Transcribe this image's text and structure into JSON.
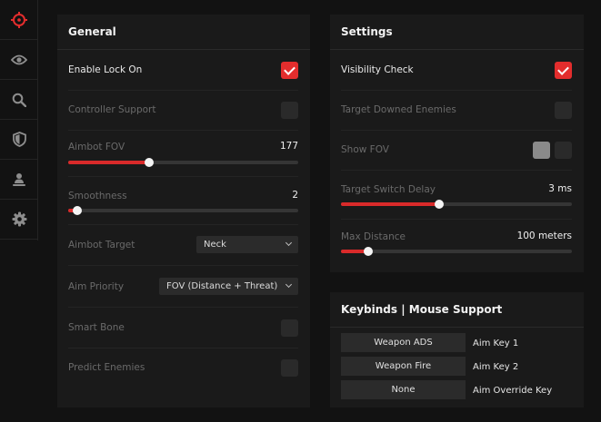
{
  "colors": {
    "accent": "#e32d2d",
    "panel": "#1a1a1a",
    "background": "#121212"
  },
  "sidebar": {
    "items": [
      {
        "icon": "crosshair-icon"
      },
      {
        "icon": "eye-icon"
      },
      {
        "icon": "search-icon"
      },
      {
        "icon": "shield-icon"
      },
      {
        "icon": "person-icon"
      },
      {
        "icon": "gear-icon"
      }
    ]
  },
  "general": {
    "title": "General",
    "enable_lock_on": {
      "label": "Enable Lock On",
      "checked": true
    },
    "controller_support": {
      "label": "Controller Support",
      "checked": false
    },
    "aimbot_fov": {
      "label": "Aimbot FOV",
      "value": "177",
      "fraction": 0.35
    },
    "smoothness": {
      "label": "Smoothness",
      "value": "2",
      "fraction": 0.04
    },
    "aimbot_target": {
      "label": "Aimbot Target",
      "selected": "Neck"
    },
    "aim_priority": {
      "label": "Aim Priority",
      "selected": "FOV (Distance + Threat)"
    },
    "smart_bone": {
      "label": "Smart Bone",
      "checked": false
    },
    "predict_enemies": {
      "label": "Predict Enemies",
      "checked": false
    }
  },
  "settings": {
    "title": "Settings",
    "visibility_check": {
      "label": "Visibility Check",
      "checked": true
    },
    "target_downed_enemies": {
      "label": "Target Downed Enemies",
      "checked": false
    },
    "show_fov": {
      "label": "Show FOV",
      "colors": [
        "#8a8a8a",
        "#2a2a2a"
      ]
    },
    "target_switch_delay": {
      "label": "Target Switch Delay",
      "value": "3 ms",
      "fraction": 0.425
    },
    "max_distance": {
      "label": "Max Distance",
      "value": "100 meters",
      "fraction": 0.12
    }
  },
  "keybinds": {
    "title": "Keybinds | Mouse Support",
    "rows": [
      {
        "button": "Weapon ADS",
        "label": "Aim Key 1"
      },
      {
        "button": "Weapon Fire",
        "label": "Aim Key 2"
      },
      {
        "button": "None",
        "label": "Aim Override Key"
      }
    ]
  }
}
